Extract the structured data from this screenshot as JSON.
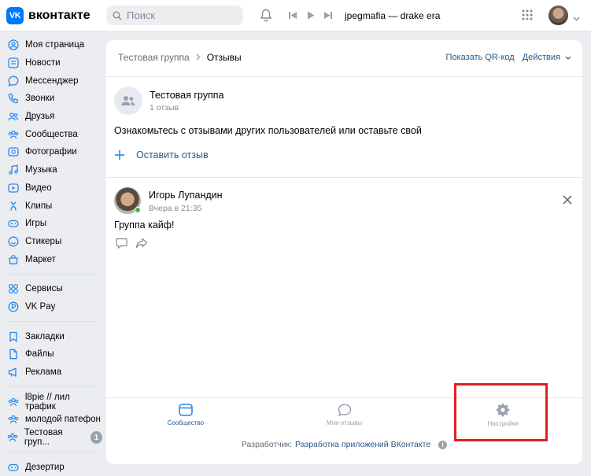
{
  "topbar": {
    "logo_mark": "VK",
    "logo_text": "вконтакте",
    "search_placeholder": "Поиск",
    "track": "jpegmafia — drake era"
  },
  "sidebar": {
    "main": [
      {
        "label": "Моя страница",
        "icon": "user-circle-icon"
      },
      {
        "label": "Новости",
        "icon": "news-icon"
      },
      {
        "label": "Мессенджер",
        "icon": "message-icon"
      },
      {
        "label": "Звонки",
        "icon": "phone-icon"
      },
      {
        "label": "Друзья",
        "icon": "friends-icon"
      },
      {
        "label": "Сообщества",
        "icon": "communities-icon"
      },
      {
        "label": "Фотографии",
        "icon": "photo-icon"
      },
      {
        "label": "Музыка",
        "icon": "music-icon"
      },
      {
        "label": "Видео",
        "icon": "video-icon"
      },
      {
        "label": "Клипы",
        "icon": "clips-icon"
      },
      {
        "label": "Игры",
        "icon": "games-icon"
      },
      {
        "label": "Стикеры",
        "icon": "stickers-icon"
      },
      {
        "label": "Маркет",
        "icon": "market-icon"
      }
    ],
    "services": [
      {
        "label": "Сервисы",
        "icon": "services-icon"
      },
      {
        "label": "VK Pay",
        "icon": "vkpay-icon"
      }
    ],
    "extra": [
      {
        "label": "Закладки",
        "icon": "bookmark-icon"
      },
      {
        "label": "Файлы",
        "icon": "file-icon"
      },
      {
        "label": "Реклама",
        "icon": "megaphone-icon"
      }
    ],
    "groups": [
      {
        "label": "l8pie // лил трафик",
        "icon": "group-icon"
      },
      {
        "label": "молодой патефон",
        "icon": "group-icon"
      },
      {
        "label": "Тестовая груп...",
        "icon": "group-icon",
        "badge": "1"
      }
    ],
    "bottom": [
      {
        "label": "Дезертир",
        "icon": "games-icon"
      }
    ]
  },
  "main": {
    "breadcrumb": {
      "group": "Тестовая группа",
      "current": "Отзывы"
    },
    "qr_label": "Показать QR-код",
    "actions_label": "Действия",
    "group_name": "Тестовая группа",
    "reviews_count": "1 отзыв",
    "intro": "Ознакомьтесь с отзывами других пользователей или оставьте свой",
    "leave_review": "Оставить отзыв",
    "review": {
      "author": "Игорь Лупандин",
      "time": "Вчера в 21:35",
      "text": "Группа кайф!"
    },
    "bottom_nav": [
      {
        "label": "Сообщество",
        "icon": "community-icon",
        "active": true
      },
      {
        "label": "Мои отзывы",
        "icon": "message-icon",
        "active": false
      },
      {
        "label": "Настройки",
        "icon": "gear-icon",
        "active": false
      }
    ],
    "developer_label": "Разработчик:",
    "developer_link": "Разработка приложений ВКонтакте"
  },
  "colors": {
    "accent": "#0077ff",
    "link": "#2a5885",
    "highlight": "#e02020",
    "online": "#4bb34b"
  }
}
